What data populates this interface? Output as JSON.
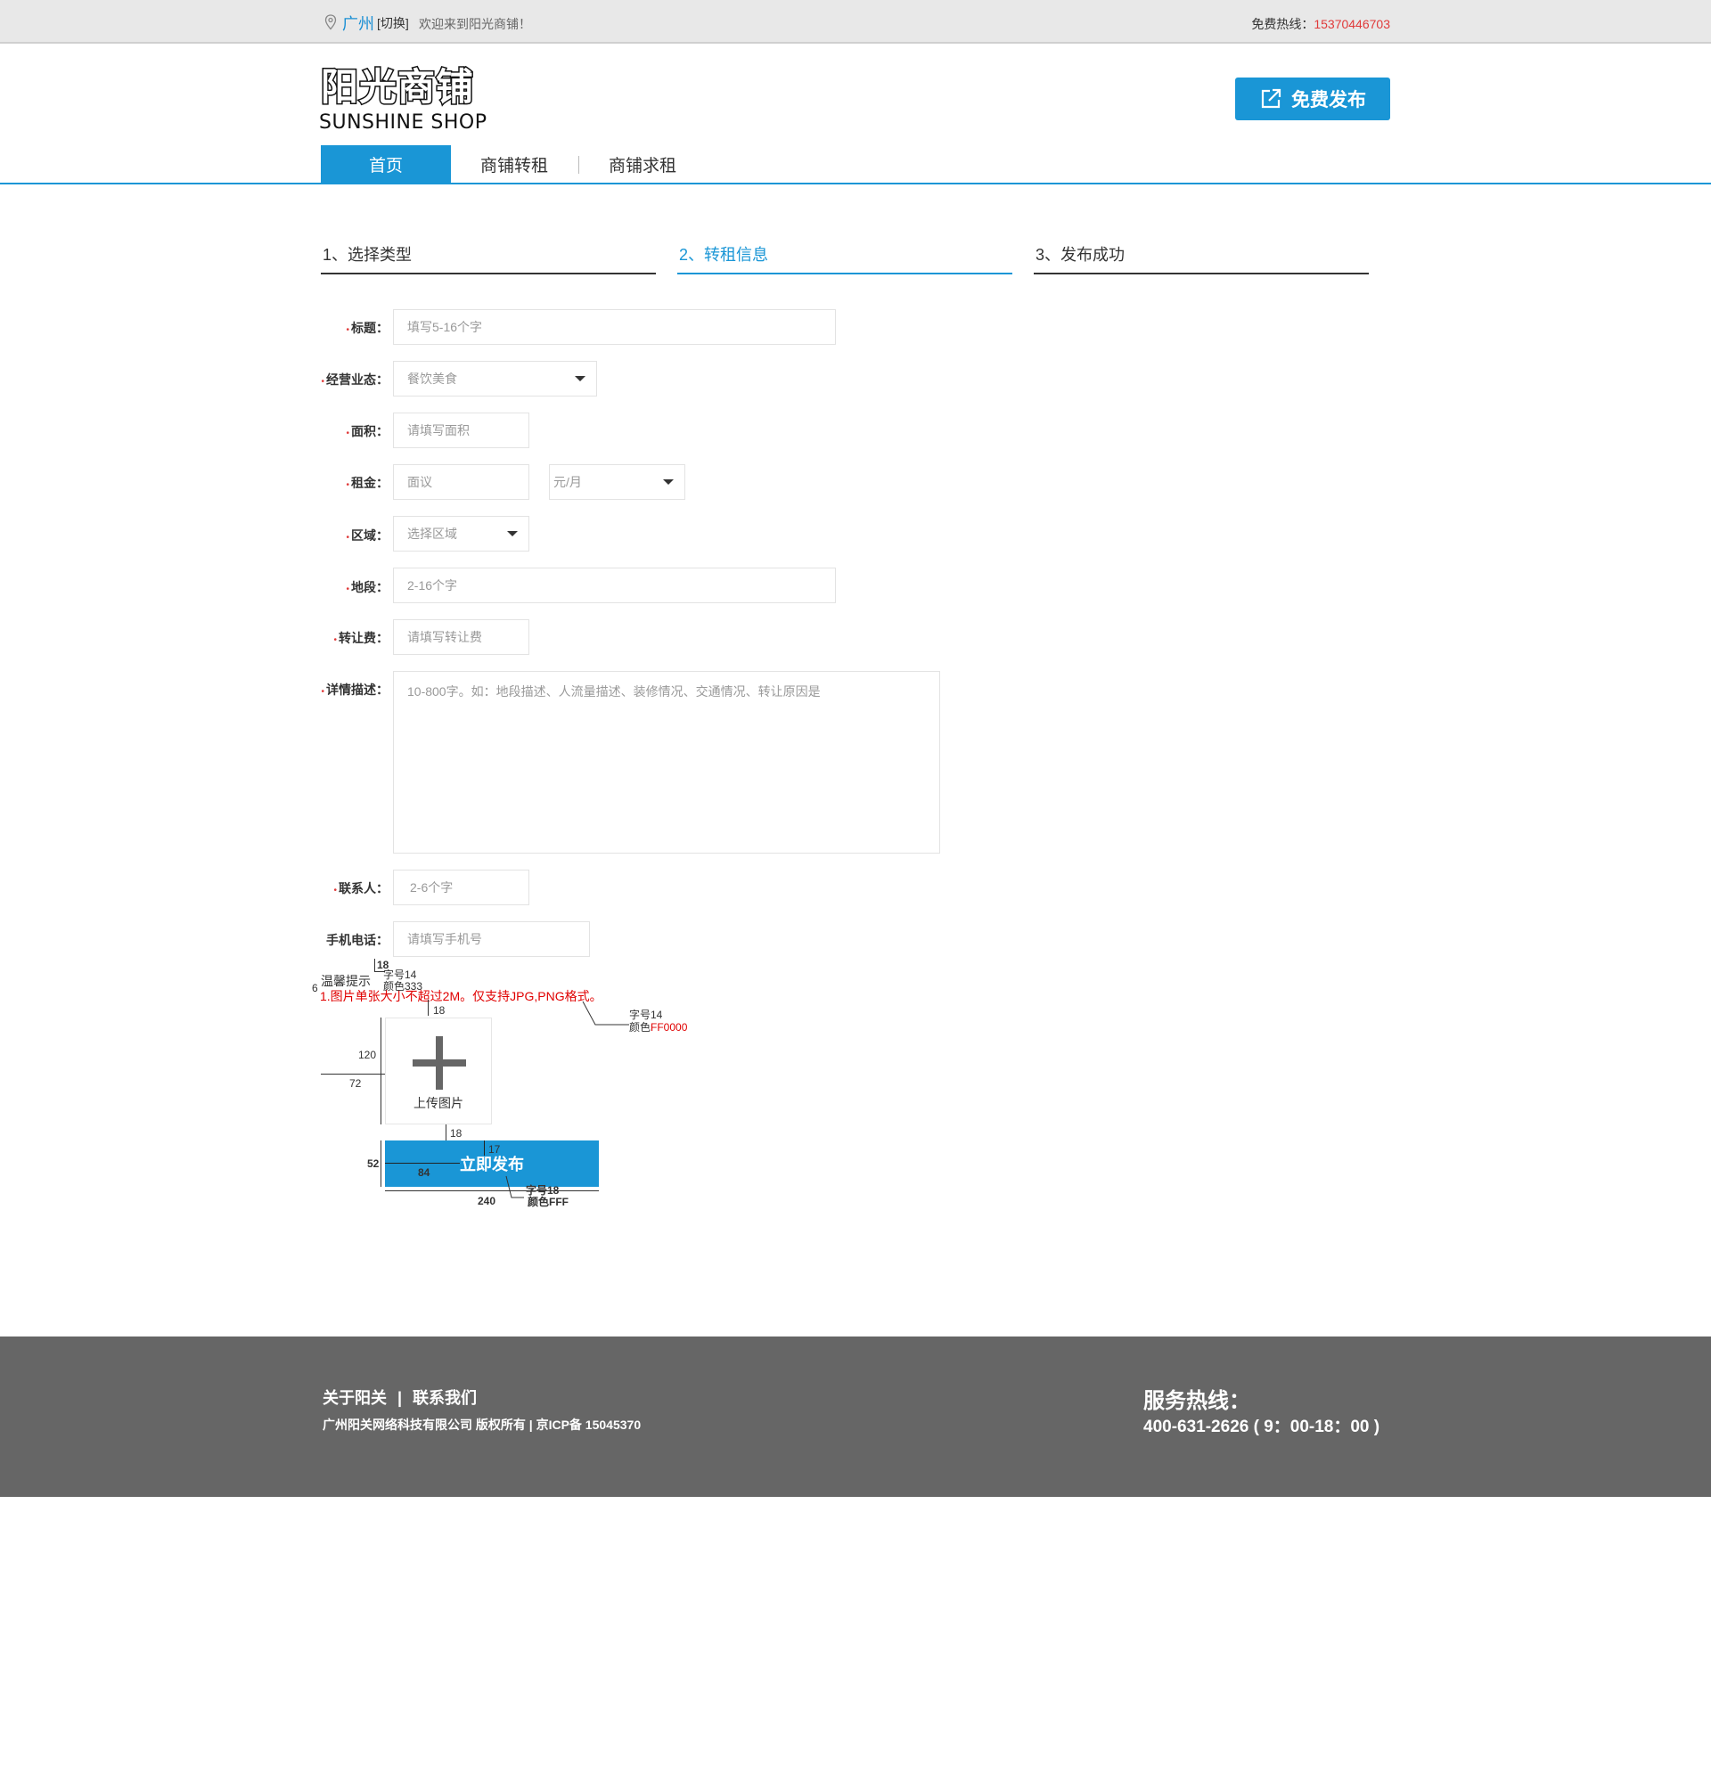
{
  "topbar": {
    "city": "广州",
    "switch": "[切换]",
    "welcome": "欢迎来到阳光商铺！",
    "hotline_label": "免费热线：",
    "hotline_number": "15370446703"
  },
  "header": {
    "logo_cn": "阳光商铺",
    "logo_en": "SUNSHINE SHOP",
    "publish_button": "免费发布"
  },
  "nav": {
    "items": [
      {
        "label": "首页"
      },
      {
        "label": "商铺转租"
      },
      {
        "label": "商铺求租"
      }
    ]
  },
  "steps": [
    {
      "label": "1、选择类型"
    },
    {
      "label": "2、转租信息"
    },
    {
      "label": "3、发布成功"
    }
  ],
  "form": {
    "required_mark": "•",
    "title": {
      "label": "标题：",
      "placeholder": "填写5-16个字"
    },
    "business": {
      "label": "经营业态：",
      "value": "餐饮美食"
    },
    "area": {
      "label": "面积：",
      "placeholder": "请填写面积"
    },
    "rent": {
      "label": "租金：",
      "placeholder": "面议",
      "unit": "元/月"
    },
    "region": {
      "label": "区域：",
      "value": "选择区域"
    },
    "section": {
      "label": "地段：",
      "placeholder": "2-16个字"
    },
    "transfer_fee": {
      "label": "转让费：",
      "placeholder": "请填写转让费"
    },
    "description": {
      "label": "详情描述：",
      "placeholder": "10-800字。如：地段描述、人流量描述、装修情况、交通情况、转让原因是"
    },
    "contact": {
      "label": "联系人：",
      "placeholder": "2-6个字"
    },
    "phone": {
      "label": "手机电话：",
      "placeholder": "请填写手机号"
    }
  },
  "tips": {
    "title": "温馨提示",
    "text": "1.图片单张大小不超过2M。仅支持JPG,PNG格式。"
  },
  "annotations": {
    "a18_top": "18",
    "font14": "字号14",
    "color333": "颜色333",
    "a6": "6",
    "a18_b": "18",
    "red_font14": "字号14",
    "red_color_prefix": "颜色",
    "red_color_code": "FF0000",
    "a120": "120",
    "a72": "72",
    "a18_c": "18",
    "a17": "17",
    "a52": "52",
    "a84": "84",
    "a240": "240",
    "font18": "字号18",
    "colorFFF": "颜色FFF"
  },
  "upload": {
    "label": "上传图片"
  },
  "submit": {
    "label": "立即发布"
  },
  "footer": {
    "about": "关于阳关",
    "separator": "|",
    "contact": "联系我们",
    "copyright": "广州阳关网络科技有限公司 版权所有 | 京ICP备 15045370",
    "service_title": "服务热线：",
    "service_number": "400-631-2626 ( 9：00-18：00 )"
  },
  "colors": {
    "accent": "#1a96d6",
    "hotline": "#e03a3a",
    "footer_bg": "#666666",
    "tip_red": "#e00000"
  }
}
